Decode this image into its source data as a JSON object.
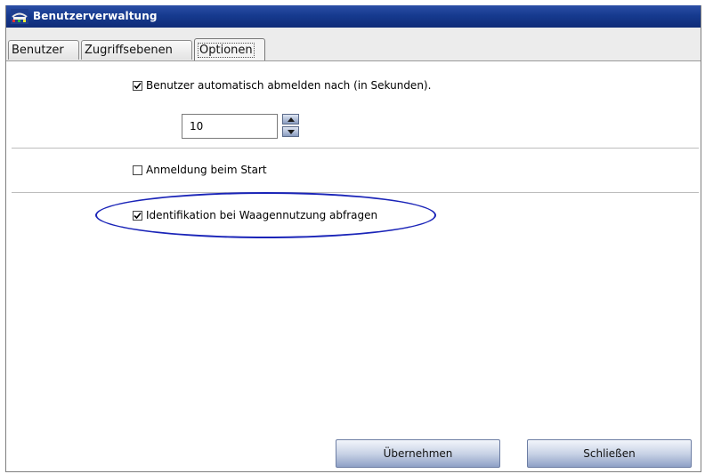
{
  "window": {
    "title": "Benutzerverwaltung"
  },
  "tabs": [
    {
      "label": "Benutzer"
    },
    {
      "label": "Zugriffsebenen"
    },
    {
      "label": "Optionen"
    }
  ],
  "options": {
    "auto_logout": {
      "label": "Benutzer automatisch abmelden nach (in Sekunden).",
      "checked": true
    },
    "timeout_value": "10",
    "login_at_start": {
      "label": "Anmeldung beim Start",
      "checked": false
    },
    "identification": {
      "label": "Identifikation bei Waagennutzung abfragen",
      "checked": true
    }
  },
  "buttons": {
    "apply": "Übernehmen",
    "close": "Schließen"
  },
  "colors": {
    "titlebar": "#163a8f",
    "highlight_ellipse": "#1a24b8"
  },
  "icons": {
    "title": "app-window-icon",
    "spin_up": "arrow-up-icon",
    "spin_down": "arrow-down-icon"
  }
}
